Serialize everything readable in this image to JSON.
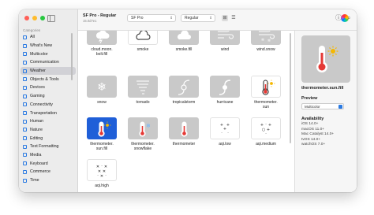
{
  "toolbar": {
    "font_name": "SF Pro - Regular",
    "font_version": "15.0d7e1",
    "font_select": "SF Pro",
    "weight_select": "Regular"
  },
  "sidebar": {
    "heading": "Categories",
    "items": [
      {
        "label": "All",
        "selected": false
      },
      {
        "label": "What's New",
        "selected": false
      },
      {
        "label": "Multicolor",
        "selected": false
      },
      {
        "label": "Communication",
        "selected": false
      },
      {
        "label": "Weather",
        "selected": true
      },
      {
        "label": "Objects & Tools",
        "selected": false
      },
      {
        "label": "Devices",
        "selected": false
      },
      {
        "label": "Gaming",
        "selected": false
      },
      {
        "label": "Connectivity",
        "selected": false
      },
      {
        "label": "Transportation",
        "selected": false
      },
      {
        "label": "Human",
        "selected": false
      },
      {
        "label": "Nature",
        "selected": false
      },
      {
        "label": "Editing",
        "selected": false
      },
      {
        "label": "Text Formatting",
        "selected": false
      },
      {
        "label": "Media",
        "selected": false
      },
      {
        "label": "Keyboard",
        "selected": false
      },
      {
        "label": "Commerce",
        "selected": false
      },
      {
        "label": "Time",
        "selected": false
      }
    ]
  },
  "symbols": [
    {
      "name": "cloud.moon.bolt.fill",
      "icon": "cloud-moon-bolt-icon"
    },
    {
      "name": "smoke",
      "icon": "smoke-icon"
    },
    {
      "name": "smoke.fill",
      "icon": "smoke-fill-icon"
    },
    {
      "name": "wind",
      "icon": "wind-icon"
    },
    {
      "name": "wind.snow",
      "icon": "wind-snow-icon"
    },
    {
      "name": "snow",
      "icon": "snow-icon"
    },
    {
      "name": "tornado",
      "icon": "tornado-icon"
    },
    {
      "name": "tropicalstorm",
      "icon": "tropicalstorm-icon"
    },
    {
      "name": "hurricane",
      "icon": "hurricane-icon"
    },
    {
      "name": "thermometer.sun",
      "icon": "thermometer-sun-icon"
    },
    {
      "name": "thermometer.sun.fill",
      "icon": "thermometer-sun-fill-icon"
    },
    {
      "name": "thermometer.snowflake",
      "icon": "thermometer-snowflake-icon"
    },
    {
      "name": "thermometer",
      "icon": "thermometer-icon"
    },
    {
      "name": "aqi.low",
      "icon": "aqi-low-icon"
    },
    {
      "name": "aqi.medium",
      "icon": "aqi-medium-icon"
    },
    {
      "name": "aqi.high",
      "icon": "aqi-high-icon"
    }
  ],
  "inspector": {
    "symbol_name": "thermometer.sun.fill",
    "preview_label": "Preview",
    "rendering_mode": "Multicolor",
    "availability_label": "Availability",
    "availability": [
      "iOS 14.0+",
      "macOS 11.0+",
      "Mac Catalyst 14.0+",
      "tvOS 14.0+",
      "watchOS 7.0+"
    ]
  },
  "colors": {
    "selection_blue": "#1f5fd8",
    "thermo_red": "#e53935",
    "sun_yellow": "#f5b800",
    "accent": "#2a7ae2"
  }
}
